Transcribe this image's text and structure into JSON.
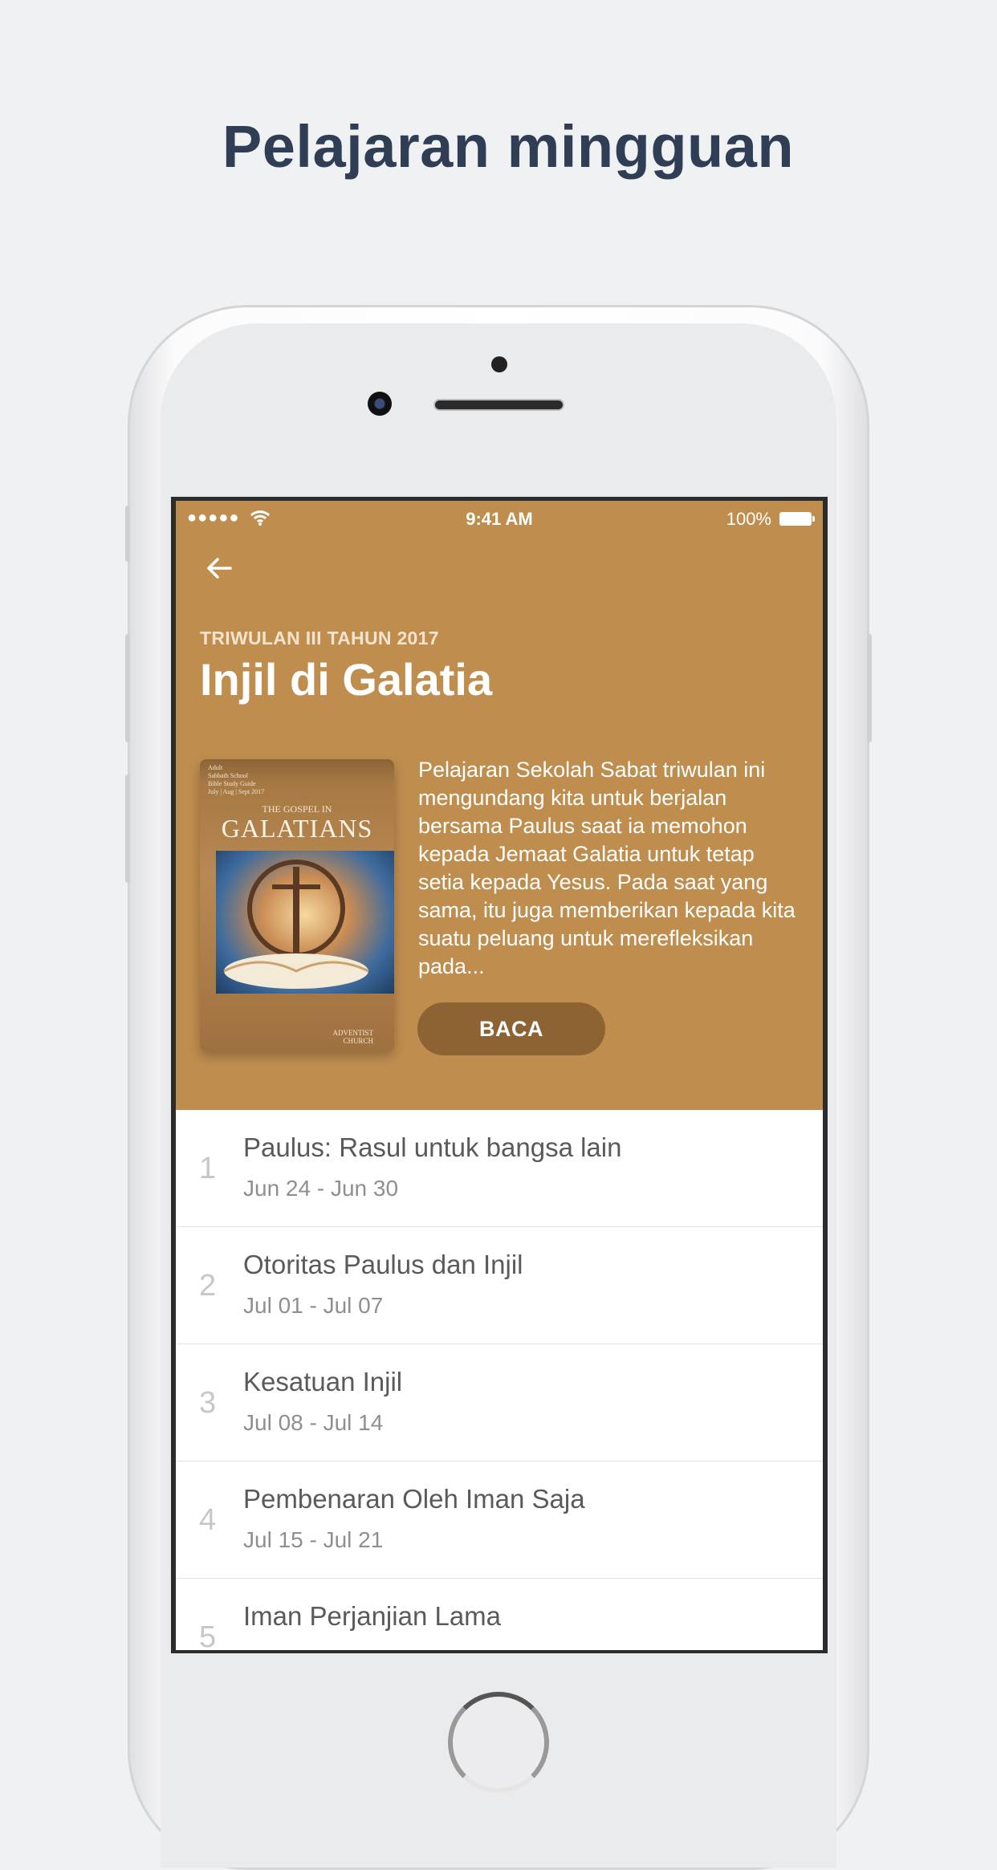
{
  "promo": {
    "title": "Pelajaran mingguan"
  },
  "status_bar": {
    "signal": "●●●●●",
    "time": "9:41 AM",
    "battery": "100%"
  },
  "header": {
    "quarter": "TRIWULAN III TAHUN 2017",
    "title": "Injil di Galatia",
    "description": "Pelajaran Sekolah Sabat triwulan ini mengundang kita untuk berjalan bersama Paulus saat ia memohon kepada Jemaat Galatia untuk tetap setia kepada Yesus. Pada saat yang sama, itu juga memberikan kepada kita suatu peluang untuk merefleksikan pada...",
    "read_button": "BACA",
    "cover": {
      "small_text": [
        "Adult",
        "Sabbath School",
        "Bible Study Guide",
        "July | Aug | Sept 2017"
      ],
      "gospel_in": "THE GOSPEL IN",
      "galatians": "GALATIANS",
      "publisher": "ADVENTIST",
      "publisher_line2": "CHURCH"
    }
  },
  "lessons": [
    {
      "number": "1",
      "title": "Paulus: Rasul untuk bangsa lain",
      "dates": "Jun 24 - Jun 30"
    },
    {
      "number": "2",
      "title": "Otoritas Paulus dan Injil",
      "dates": "Jul 01 - Jul 07"
    },
    {
      "number": "3",
      "title": "Kesatuan Injil",
      "dates": "Jul 08 - Jul 14"
    },
    {
      "number": "4",
      "title": "Pembenaran Oleh Iman Saja",
      "dates": "Jul 15 - Jul 21"
    },
    {
      "number": "5",
      "title": "Iman Perjanjian Lama",
      "dates": ""
    }
  ],
  "colors": {
    "header": "#bf8e4f",
    "button": "#8e6333",
    "promo_title": "#2f3d55"
  }
}
